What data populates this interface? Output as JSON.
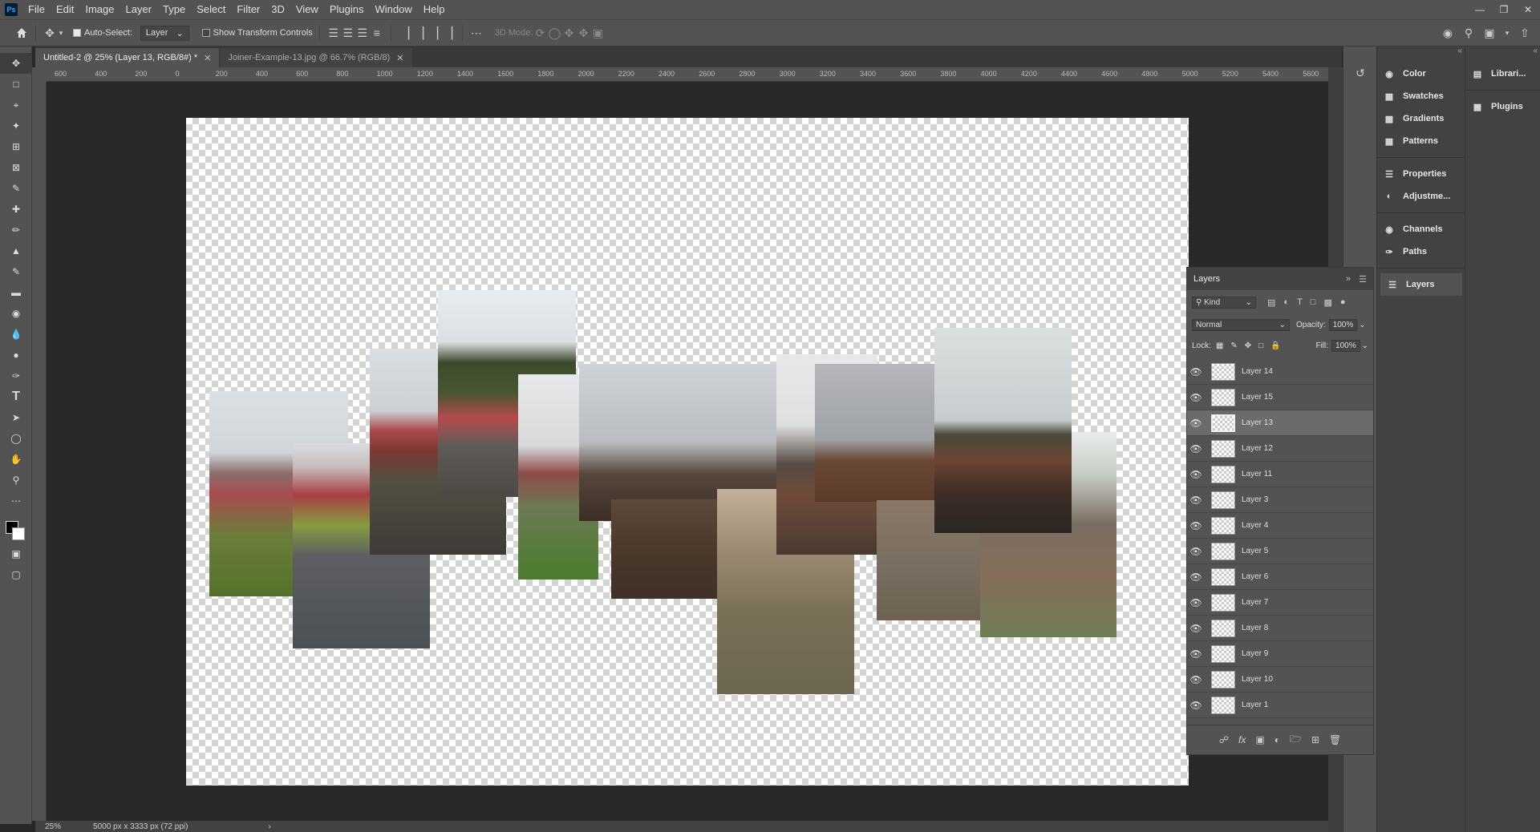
{
  "app": {
    "logo_text": "Ps"
  },
  "menu": [
    "File",
    "Edit",
    "Image",
    "Layer",
    "Type",
    "Select",
    "Filter",
    "3D",
    "View",
    "Plugins",
    "Window",
    "Help"
  ],
  "options": {
    "auto_select_label": "Auto-Select:",
    "auto_select_value": "Layer",
    "show_transform_label": "Show Transform Controls",
    "mode_3d_label": "3D Mode:"
  },
  "tabs": [
    {
      "label": "Untitled-2 @ 25% (Layer 13, RGB/8#) *",
      "active": true
    },
    {
      "label": "Joiner-Example-13.jpg @ 66.7% (RGB/8)",
      "active": false
    }
  ],
  "ruler_ticks": [
    "600",
    "400",
    "200",
    "0",
    "200",
    "400",
    "600",
    "800",
    "1000",
    "1200",
    "1400",
    "1600",
    "1800",
    "2000",
    "2200",
    "2400",
    "2600",
    "2800",
    "3000",
    "3200",
    "3400",
    "3600",
    "3800",
    "4000",
    "4200",
    "4400",
    "4600",
    "4800",
    "5000",
    "5200",
    "5400",
    "5600"
  ],
  "status": {
    "zoom": "25%",
    "doc_info": "5000 px x 3333 px (72 ppi)"
  },
  "panels_col1": [
    "Color",
    "Swatches",
    "Gradients",
    "Patterns",
    "Properties",
    "Adjustme...",
    "Channels",
    "Paths",
    "Layers"
  ],
  "panels_col2": [
    "Librari...",
    "Plugins"
  ],
  "layers_panel": {
    "title": "Layers",
    "filter_label": "Kind",
    "blend_mode": "Normal",
    "opacity_label": "Opacity:",
    "opacity_value": "100%",
    "lock_label": "Lock:",
    "fill_label": "Fill:",
    "fill_value": "100%",
    "layers": [
      {
        "name": "Layer 14",
        "selected": false
      },
      {
        "name": "Layer 15",
        "selected": false
      },
      {
        "name": "Layer 13",
        "selected": true
      },
      {
        "name": "Layer 12",
        "selected": false
      },
      {
        "name": "Layer 11",
        "selected": false
      },
      {
        "name": "Layer 3",
        "selected": false
      },
      {
        "name": "Layer 4",
        "selected": false
      },
      {
        "name": "Layer 5",
        "selected": false
      },
      {
        "name": "Layer 6",
        "selected": false
      },
      {
        "name": "Layer 7",
        "selected": false
      },
      {
        "name": "Layer 8",
        "selected": false
      },
      {
        "name": "Layer 9",
        "selected": false
      },
      {
        "name": "Layer 10",
        "selected": false
      },
      {
        "name": "Layer 1",
        "selected": false
      }
    ]
  },
  "colors": {
    "ui_bg": "#535353",
    "canvas_area": "#282828",
    "accent_ps": "#31a8ff"
  }
}
